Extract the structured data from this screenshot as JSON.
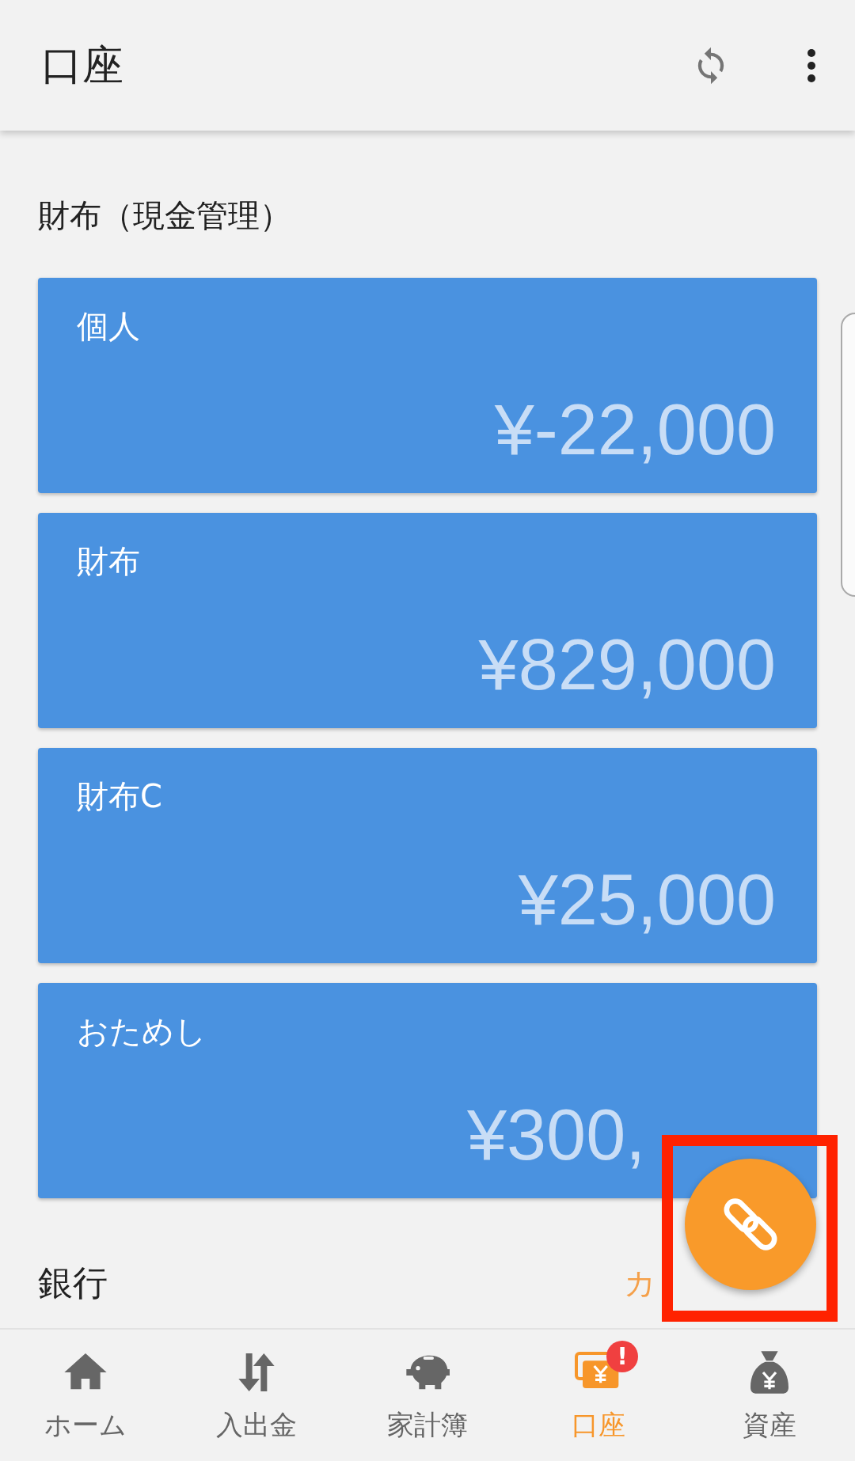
{
  "app_bar": {
    "title": "口座"
  },
  "sections": [
    {
      "title": "財布（現金管理）",
      "accounts": [
        {
          "name": "個人",
          "balance": "¥-22,000"
        },
        {
          "name": "財布",
          "balance": "¥829,000"
        },
        {
          "name": "財布C",
          "balance": "¥25,000"
        },
        {
          "name": "おためし",
          "balance": "¥300,",
          "covered": true
        }
      ]
    },
    {
      "title": "銀行",
      "action": "カ",
      "action_covered": true
    }
  ],
  "bottom_nav": [
    {
      "label": "ホーム",
      "kind": "home",
      "selected": false
    },
    {
      "label": "入出金",
      "kind": "transfer",
      "selected": false
    },
    {
      "label": "家計簿",
      "kind": "piggy",
      "selected": false
    },
    {
      "label": "口座",
      "kind": "card",
      "selected": true,
      "badge": "!"
    },
    {
      "label": "資産",
      "kind": "bag",
      "selected": false
    }
  ]
}
